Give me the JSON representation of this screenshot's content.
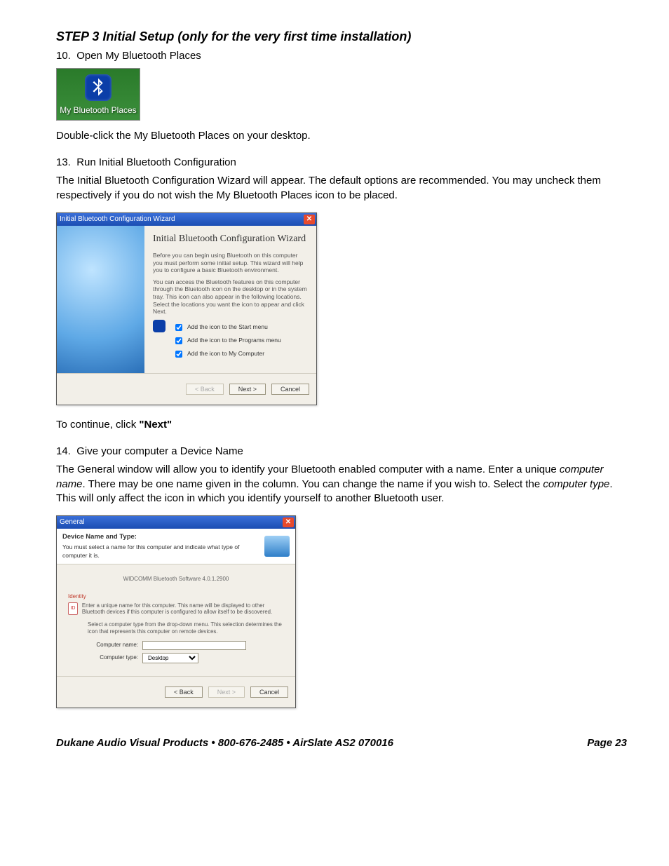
{
  "heading": "STEP 3 Initial Setup (only for the very first time installation)",
  "step10_num": "10.",
  "step10_text": "Open My Bluetooth Places",
  "desktop_icon_label": "My Bluetooth Places",
  "after_icon": "Double-click the My Bluetooth Places on your desktop.",
  "step13_num": "13.",
  "step13_title": "Run Initial Bluetooth Configuration",
  "step13_body": "The Initial Bluetooth Configuration Wizard will appear.  The default options are recommended.  You may uncheck them respectively if you do not wish the My Bluetooth Places icon to be placed.",
  "wizard1": {
    "title": "Initial Bluetooth Configuration Wizard",
    "heading": "Initial Bluetooth Configuration Wizard",
    "p1": "Before you can begin using Bluetooth on this computer you must perform some initial setup. This wizard will help you to configure a basic Bluetooth environment.",
    "p2": "You can access the Bluetooth features on this computer through the Bluetooth icon on the desktop or in the system tray. This icon can also appear in the following locations. Select the locations you want the icon to appear and click Next.",
    "chk1": "Add the icon to the Start menu",
    "chk2": "Add the icon to the Programs menu",
    "chk3": "Add the icon to My Computer",
    "back": "< Back",
    "next": "Next >",
    "cancel": "Cancel"
  },
  "continue_line_a": "To continue, click ",
  "continue_line_b": "\"Next\"",
  "step14_num": "14.",
  "step14_title": "Give your computer a Device Name",
  "step14_body_a": "The General window will allow you to identify your Bluetooth enabled computer with a name.  Enter a unique ",
  "term_computer_name": "computer name",
  "step14_body_b": ". There may be one name given in the column. You can change the name if you wish to.  Select the ",
  "term_computer_type": "computer type",
  "step14_body_c": ".  This will only affect the icon in which you identify yourself to another Bluetooth user.",
  "wizard2": {
    "title": "General",
    "hdr_bold": "Device Name and Type:",
    "hdr_text": "You must select a name for this computer and indicate what type of computer it is.",
    "center": "WIDCOMM Bluetooth Software 4.0.1.2900",
    "identity_label": "Identity",
    "id_text1": "Enter a unique name for this computer. This name will be displayed to other Bluetooth devices if this computer is configured to allow itself to be discovered.",
    "id_text2": "Select a computer type from the drop-down menu. This selection determines the icon that represents this computer on remote devices.",
    "lbl_name": "Computer name:",
    "lbl_type": "Computer type:",
    "type_value": "Desktop",
    "back": "< Back",
    "next": "Next >",
    "cancel": "Cancel"
  },
  "footer_left": "Dukane Audio Visual Products • 800-676-2485 • AirSlate AS2 070016",
  "footer_right": "Page 23"
}
